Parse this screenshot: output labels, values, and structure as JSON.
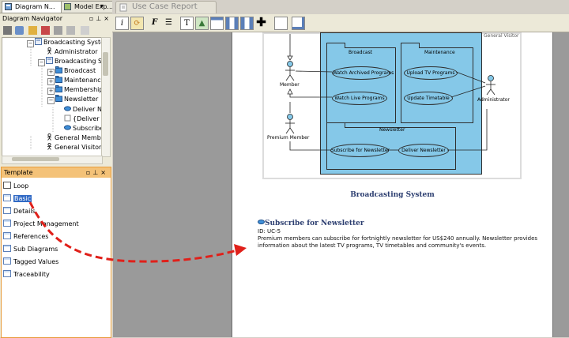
{
  "left_tabs": [
    {
      "label": "Diagram N..."
    },
    {
      "label": "Model Exp..."
    }
  ],
  "navigator": {
    "title": "Diagram Navigator",
    "tree": [
      {
        "label": "Broadcasting System",
        "icon": "diagram-icon"
      },
      {
        "label": "Administrator",
        "icon": "actor-icon"
      },
      {
        "label": "Broadcasting Syst",
        "icon": "diagram-icon"
      },
      {
        "label": "Broadcast",
        "icon": "package-icon"
      },
      {
        "label": "Maintenance",
        "icon": "package-icon"
      },
      {
        "label": "Membership",
        "icon": "package-icon"
      },
      {
        "label": "Newsletter",
        "icon": "package-icon"
      },
      {
        "label": "Deliver Ne",
        "icon": "use-case-icon"
      },
      {
        "label": "{Deliver Ne",
        "icon": "note-icon"
      },
      {
        "label": "Subscribe",
        "icon": "use-case-icon"
      },
      {
        "label": "General Member",
        "icon": "actor-icon"
      },
      {
        "label": "General Visitor",
        "icon": "actor-icon"
      }
    ]
  },
  "template_panel": {
    "title": "Template",
    "items": [
      {
        "label": "Loop"
      },
      {
        "label": "Basic"
      },
      {
        "label": "Details"
      },
      {
        "label": "Project Management"
      },
      {
        "label": "References"
      },
      {
        "label": "Sub Diagrams"
      },
      {
        "label": "Tagged Values"
      },
      {
        "label": "Traceability"
      }
    ]
  },
  "editor_tab": {
    "label": "Use Case Report"
  },
  "toolbar": {
    "italic_label": "i",
    "font_label": "F",
    "text_label": "T"
  },
  "diagram": {
    "system_label": "General Visitor",
    "packages": [
      {
        "name": "Broadcast"
      },
      {
        "name": "Maintenance"
      },
      {
        "name": "Newsletter"
      }
    ],
    "use_cases": [
      {
        "name": "Watch Archived Programs"
      },
      {
        "name": "Watch Live Programs"
      },
      {
        "name": "Upload TV Programs"
      },
      {
        "name": "Update Timetable"
      },
      {
        "name": "Subscribe for Newsletter"
      },
      {
        "name": "Deliver Newsletter"
      }
    ],
    "actors": [
      {
        "name": "Member"
      },
      {
        "name": "Premium Member"
      },
      {
        "name": "Administrator"
      }
    ]
  },
  "report": {
    "diagram_caption": "Broadcasting System",
    "section_title": "Subscribe for Newsletter",
    "id_line": "ID: UC-5",
    "desc_line1": "Premium members can subscribe for fortnightly newsletter for US$240 annually. Newsletter provides",
    "desc_line2": "information about the latest TV programs, TV timetables and community's events."
  },
  "colors": {
    "package_fill": "#85c8e8",
    "selection": "#316ac5",
    "arrow": "#e0201a",
    "heading": "#2c3e70"
  }
}
